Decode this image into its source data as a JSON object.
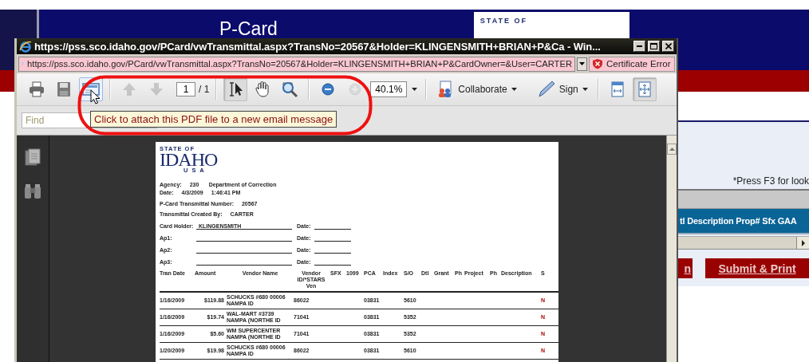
{
  "background_page": {
    "header_title": "P-Card",
    "logo_caption": "STATE OF",
    "note": "*Press F3 for look",
    "grid_header": "tl Description Prop# Sfx GAA",
    "buttons": [
      "n",
      "Submit & Print"
    ]
  },
  "window": {
    "title": "https://pss.sco.idaho.gov/PCard/vwTransmittal.aspx?TransNo=20567&Holder=KLINGENSMITH+BRIAN+P&Ca - Win...",
    "address": "https://pss.sco.idaho.gov/PCard/vwTransmittal.aspx?TransNo=20567&Holder=KLINGENSMITH+BRIAN+P&CardOwner=&User=CARTER",
    "certificate_status": "Certificate Error"
  },
  "toolbar": {
    "buttons": [
      {
        "selected": false,
        "hovered": false,
        "disabled": false
      },
      {
        "selected": false,
        "hovered": false,
        "disabled": false
      },
      {
        "selected": false,
        "hovered": true,
        "disabled": false
      },
      {
        "selected": false,
        "hovered": false,
        "disabled": true
      },
      {
        "selected": false,
        "hovered": false,
        "disabled": true
      },
      {
        "selected": true,
        "hovered": false,
        "disabled": false
      },
      {
        "selected": false,
        "hovered": false,
        "disabled": false
      },
      {
        "selected": false,
        "hovered": false,
        "disabled": false
      },
      {
        "selected": false,
        "hovered": false,
        "disabled": false
      },
      {
        "selected": false,
        "hovered": false,
        "disabled": true
      },
      {
        "selected": false,
        "hovered": false,
        "disabled": false
      },
      {
        "selected": true,
        "hovered": false,
        "disabled": false
      }
    ],
    "page_number": "1",
    "page_total": "/ 1",
    "zoom": "40.1%",
    "menus": [
      "Collaborate",
      "Sign"
    ]
  },
  "find": {
    "placeholder": "Find"
  },
  "tooltip": "Click to attach this PDF file to a new email message",
  "document": {
    "logo": {
      "caption": "STATE OF",
      "name": "IDAHO",
      "country": "U S A"
    },
    "info_lines": [
      [
        "Agency:",
        "230",
        "Department of Correction"
      ],
      [
        "Date:",
        "4/3/2009",
        "1:46:41 PM"
      ],
      [
        "P-Card Transmittal Number:",
        "20567"
      ],
      [
        "Transmittal Created By:",
        "CARTER"
      ]
    ],
    "signatures": [
      {
        "label": "Card Holder:",
        "value": "KLINGENSMITH",
        "date_label": "Date:"
      },
      {
        "label": "Ap1:",
        "date_label": "Date:"
      },
      {
        "label": "Ap2:",
        "date_label": "Date:"
      },
      {
        "label": "Ap3:",
        "date_label": "Date:"
      }
    ],
    "table": {
      "columns": [
        "Tran Date",
        "Amount",
        "Vendor Name",
        "Vendor ID/*STARS Ven",
        "SFX",
        "1099",
        "PCA",
        "Index",
        "S/O",
        "Dtl",
        "Grant",
        "Ph",
        "Project",
        "Ph",
        "Description",
        "S"
      ],
      "rows": [
        {
          "tran_date": "1/16/2009",
          "amount": "$119.88",
          "vendor_name": "SCHUCKS #680 00006 NAMPA ID",
          "vendor_id": "86022",
          "pca": "03831",
          "s_o": "5610",
          "s": "N"
        },
        {
          "tran_date": "1/16/2009",
          "amount": "$19.74",
          "vendor_name": "WAL-MART #3739 NAMPA (NORTHE ID",
          "vendor_id": "71041",
          "pca": "03831",
          "s_o": "5352",
          "s": "N"
        },
        {
          "tran_date": "1/16/2009",
          "amount": "$5.60",
          "vendor_name": "WM SUPERCENTER NAMPA (NORTHE ID",
          "vendor_id": "71041",
          "pca": "03831",
          "s_o": "5352",
          "s": "N"
        },
        {
          "tran_date": "1/20/2009",
          "amount": "$19.98",
          "vendor_name": "SCHUCKS #680 00006 NAMPA ID",
          "vendor_id": "86022",
          "pca": "03831",
          "s_o": "5610",
          "s": "N"
        }
      ]
    }
  }
}
